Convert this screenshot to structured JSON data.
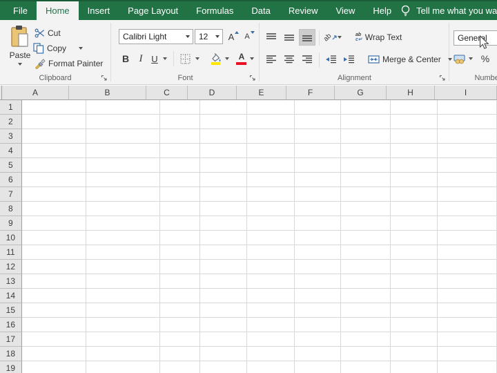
{
  "tab_bar": {
    "tabs": [
      {
        "label": "File",
        "active": false
      },
      {
        "label": "Home",
        "active": true
      },
      {
        "label": "Insert",
        "active": false
      },
      {
        "label": "Page Layout",
        "active": false
      },
      {
        "label": "Formulas",
        "active": false
      },
      {
        "label": "Data",
        "active": false
      },
      {
        "label": "Review",
        "active": false
      },
      {
        "label": "View",
        "active": false
      },
      {
        "label": "Help",
        "active": false
      }
    ],
    "tell_me": "Tell me what you want"
  },
  "ribbon": {
    "clipboard": {
      "group_label": "Clipboard",
      "paste_label": "Paste",
      "cut_label": "Cut",
      "copy_label": "Copy",
      "format_painter_label": "Format Painter"
    },
    "font": {
      "group_label": "Font",
      "font_name": "Calibri Light",
      "font_size": "12",
      "bold_label": "B",
      "italic_label": "I",
      "underline_label": "U",
      "grow_label": "A",
      "shrink_label": "A"
    },
    "alignment": {
      "group_label": "Alignment",
      "orientation_label": "ab",
      "wrap_icon_top": "ab",
      "wrap_icon_bottom": "c",
      "wrap_text_label": "Wrap Text",
      "merge_center_label": "Merge & Center"
    },
    "number": {
      "group_label": "Number",
      "format_value": "General",
      "percent_label": "%"
    }
  },
  "sheet": {
    "columns": [
      "A",
      "B",
      "C",
      "D",
      "E",
      "F",
      "G",
      "H",
      "I"
    ],
    "rows": [
      "1",
      "2",
      "3",
      "4",
      "5",
      "6",
      "7",
      "8",
      "9",
      "10",
      "11",
      "12",
      "13",
      "14",
      "15",
      "16",
      "17",
      "18",
      "19"
    ]
  },
  "colors": {
    "excel_green": "#217346",
    "ribbon_bg": "#f3f3f3",
    "fill_yellow": "#ffe600",
    "font_red": "#e81123",
    "icon_blue": "#3a6ea5"
  }
}
